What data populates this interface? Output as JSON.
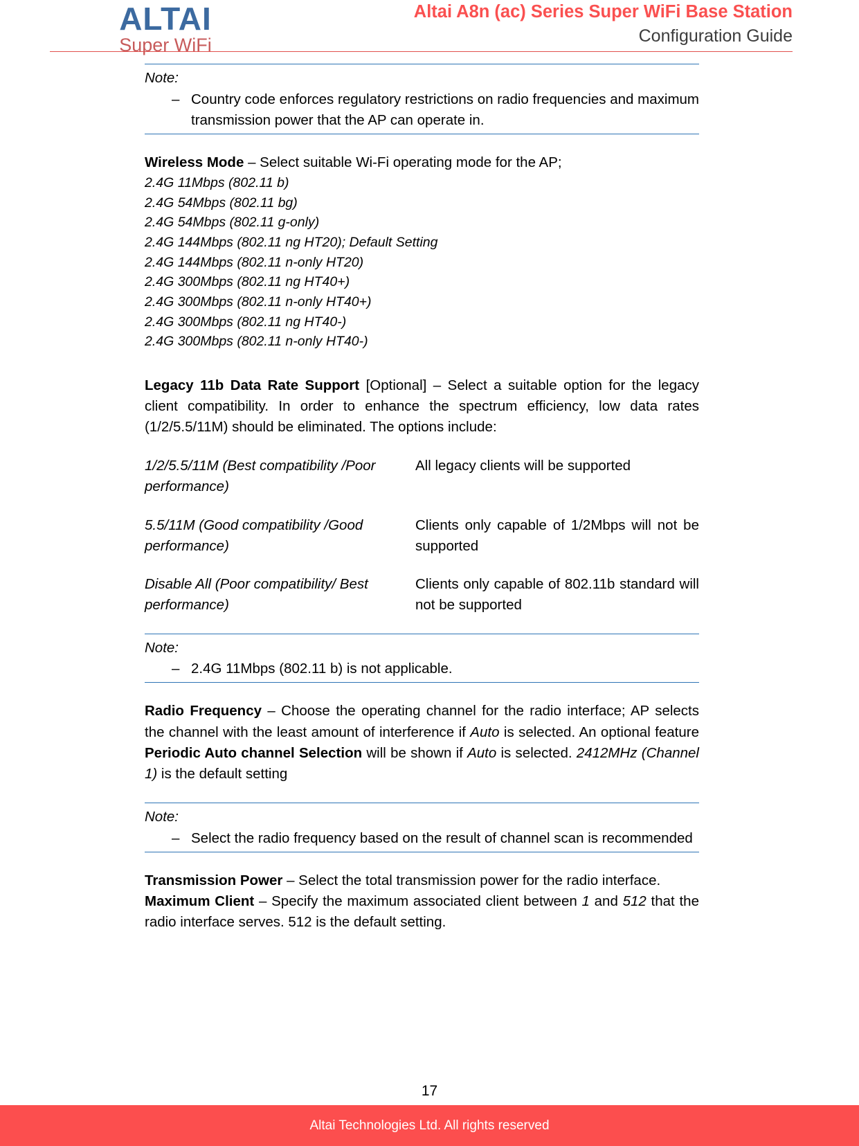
{
  "header": {
    "logo_main": "ALTAI",
    "logo_sub": "Super WiFi",
    "title": "Altai A8n (ac) Series Super WiFi Base Station",
    "subtitle": "Configuration Guide",
    "title_color": "#FA5050",
    "subtitle_color": "#3C3C3C",
    "rule_color": "#E1504E",
    "logo_main_color": "#3C6AA0",
    "logo_sub_color": "#C75B5B"
  },
  "note1": {
    "label": "Note:",
    "dash": "–",
    "text": "Country code enforces regulatory restrictions on radio frequencies and maximum transmission power that the AP can operate in.",
    "rule_color": "#2E74B5"
  },
  "wireless_mode": {
    "term": "Wireless Mode",
    "description": " – Select suitable Wi-Fi operating mode for the AP;",
    "modes": [
      "2.4G 11Mbps (802.11 b)",
      "2.4G 54Mbps (802.11 bg)",
      "2.4G 54Mbps (802.11 g-only)",
      "2.4G 144Mbps (802.11 ng HT20); Default Setting",
      "2.4G 144Mbps (802.11 n-only HT20)",
      "2.4G 300Mbps (802.11 ng HT40+)",
      "2.4G 300Mbps (802.11 n-only HT40+)",
      "2.4G 300Mbps (802.11 ng HT40-)",
      "2.4G 300Mbps (802.11 n-only HT40-)"
    ]
  },
  "legacy": {
    "term": "Legacy 11b Data Rate Support",
    "optional": " [Optional]",
    "description": " – Select a suitable option for the legacy client compatibility. In order to enhance the spectrum efficiency, low data rates (1/2/5.5/11M) should be eliminated. The options include:",
    "rows": [
      {
        "option": "1/2/5.5/11M (Best compatibility /Poor performance)",
        "effect": "All legacy clients will be supported"
      },
      {
        "option": "5.5/11M (Good compatibility /Good performance)",
        "effect": "Clients only capable of 1/2Mbps will not be supported"
      },
      {
        "option": "Disable All (Poor compatibility/ Best performance)",
        "effect": "Clients only capable of 802.11b standard will not be supported"
      }
    ]
  },
  "note2": {
    "label": "Note:",
    "dash": "–",
    "text": "2.4G 11Mbps (802.11 b) is not applicable."
  },
  "radio_frequency": {
    "term": "Radio Frequency",
    "part1": " – Choose the operating channel for the radio interface; AP selects the channel with the least amount of interference if ",
    "auto1": "Auto",
    "part2": " is selected. An optional feature ",
    "feature": "Periodic Auto channel Selection",
    "part3": " will be shown if ",
    "auto2": "Auto",
    "part4": " is selected. ",
    "default_value": "2412MHz (Channel 1)",
    "part5": " is the default setting"
  },
  "note3": {
    "label": "Note:",
    "dash": "–",
    "text": "Select the radio frequency based on the result of channel scan is recommended"
  },
  "transmission_power": {
    "term": "Transmission Power",
    "description": " – Select the total transmission power for the radio interface."
  },
  "maximum_client": {
    "term": "Maximum Client",
    "part1": " – Specify the maximum associated client between ",
    "min": "1",
    "part2": " and ",
    "max": "512",
    "part3": " that the radio interface serves. 512 is the default setting."
  },
  "footer": {
    "page_number": "17",
    "copyright": "Altai Technologies Ltd. All rights reserved",
    "bar_color": "#FC4E4E"
  }
}
